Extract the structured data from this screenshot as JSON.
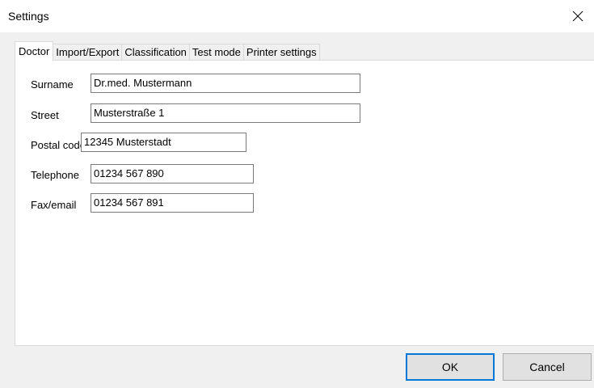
{
  "window": {
    "title": "Settings",
    "close_icon": "close-icon"
  },
  "tabs": [
    {
      "label": "Doctor",
      "active": true
    },
    {
      "label": "Import/Export",
      "active": false
    },
    {
      "label": "Classification",
      "active": false
    },
    {
      "label": "Test mode",
      "active": false
    },
    {
      "label": "Printer settings",
      "active": false
    }
  ],
  "doctor": {
    "surname": {
      "label": "Surname",
      "value": "Dr.med. Mustermann"
    },
    "street": {
      "label": "Street",
      "value": "Musterstraße 1"
    },
    "postal_code": {
      "label": "Postal code",
      "value": "12345 Musterstadt"
    },
    "telephone": {
      "label": "Telephone",
      "value": "01234 567 890"
    },
    "fax_email": {
      "label": "Fax/email",
      "value": "01234 567 891"
    }
  },
  "buttons": {
    "ok_label": "OK",
    "cancel_label": "Cancel"
  },
  "colors": {
    "window_bg": "#f0f0f0",
    "default_button_border": "#0078d7"
  }
}
